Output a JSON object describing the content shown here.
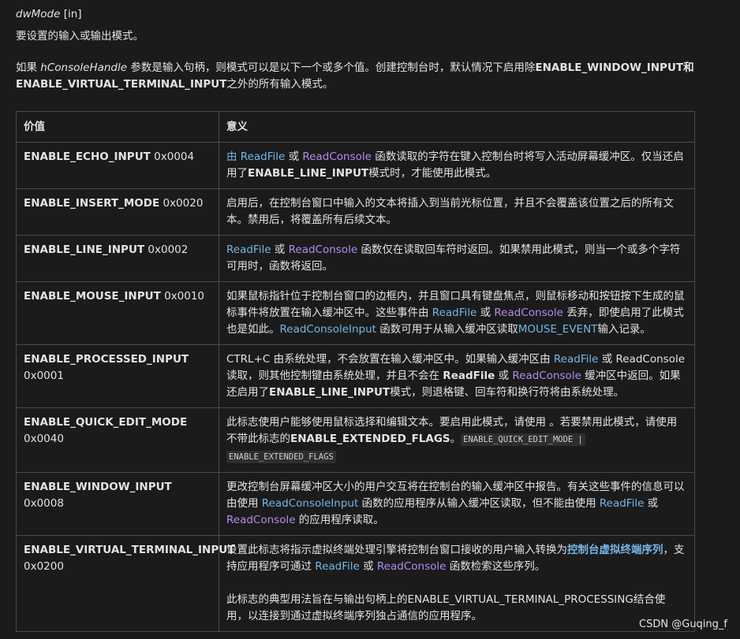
{
  "param": {
    "name": "dwMode",
    "tag": " [in]"
  },
  "description": "要设置的输入或输出模式。",
  "intro": {
    "p1": "如果 ",
    "handle": "hConsoleHandle",
    "p2": " 参数是输入句柄，则模式可以是以下一个或多个值。创建控制台时，默认情况下启用除",
    "bold": "ENABLE_WINDOW_INPUT和ENABLE_VIRTUAL_TERMINAL_INPUT",
    "p3": "之外的所有输入模式。"
  },
  "table": {
    "headers": [
      "价值",
      "意义"
    ],
    "rows": [
      {
        "name": "ENABLE_ECHO_INPUT",
        "value": " 0x0004",
        "m1": "由 ",
        "m2": "ReadFile",
        "m3": " 或 ",
        "m4": "ReadConsole",
        "m5": " 函数读取的字符在键入控制台时将写入活动屏幕缓冲区。仅当还启用了",
        "m6": "ENABLE_LINE_INPUT",
        "m7": "模式时，才能使用此模式。"
      },
      {
        "name": "ENABLE_INSERT_MODE",
        "value": " 0x0020",
        "m1": "启用后，在控制台窗口中输入的文本将插入到当前光标位置，并且不会覆盖该位置之后的所有文本。禁用后，将覆盖所有后续文本。"
      },
      {
        "name": "ENABLE_LINE_INPUT",
        "value": " 0x0002",
        "m1": "ReadFile",
        "m2": " 或 ",
        "m3": "ReadConsole",
        "m4": " 函数仅在读取回车符时返回。如果禁用此模式，则当一个或多个字符可用时，函数将返回。"
      },
      {
        "name": "ENABLE_MOUSE_INPUT",
        "value": " 0x0010",
        "m1": "如果鼠标指针位于控制台窗口的边框内，并且窗口具有键盘焦点，则鼠标移动和按钮按下生成的鼠标事件将放置在输入缓冲区中。这些事件由 ",
        "m2": "ReadFile",
        "m3": " 或 ",
        "m4": "ReadConsole",
        "m5": " 丢弃，即使启用了此模式也是如此。",
        "m6": "ReadConsoleInput",
        "m7": " 函数可用于从输入缓冲区读取",
        "m8": "MOUSE_EVENT",
        "m9": "输入记录。"
      },
      {
        "name": "ENABLE_PROCESSED_INPUT",
        "value": " 0x0001",
        "m1": "CTRL+C 由系统处理，不会放置在输入缓冲区中。如果输入缓冲区由 ",
        "m2": "ReadFile",
        "m3": " 或 ReadConsole 读取，则其他控制键由系统处理，并且不会在 ",
        "m4": "ReadFile",
        "m5": " 或 ",
        "m6": "ReadConsole",
        "m7": " 缓冲区中返回。如果还启用了",
        "m8": "ENABLE_LINE_INPUT",
        "m9": "模式，则退格键、回车符和换行符将由系统处理。"
      },
      {
        "name": "ENABLE_QUICK_EDIT_MODE",
        "value": " 0x0040",
        "m1": "此标志使用户能够使用鼠标选择和编辑文本。要启用此模式，请使用 。若要禁用此模式，请使用不带此标志的",
        "m2": "ENABLE_EXTENDED_FLAGS",
        "m3": "。",
        "code1": "ENABLE_QUICK_EDIT_MODE |",
        "code2": "ENABLE_EXTENDED_FLAGS"
      },
      {
        "name": "ENABLE_WINDOW_INPUT",
        "value": " 0x0008",
        "m1": "更改控制台屏幕缓冲区大小的用户交互将在控制台的输入缓冲区中报告。有关这些事件的信息可以由使用 ",
        "m2": "ReadConsoleInput",
        "m3": " 函数的应用程序从输入缓冲区读取，但不能由使用 ",
        "m4": "ReadFile",
        "m5": " 或 ",
        "m6": "ReadConsole",
        "m7": " 的应用程序读取。"
      },
      {
        "name": "ENABLE_VIRTUAL_TERMINAL_INPUT",
        "value": "0x0200",
        "m1": "设置此标志将指示虚拟终端处理引擎将控制台窗口接收的用户输入转换为",
        "m2": "控制台虚拟终端序列",
        "m3": "，支持应用程序可通过 ",
        "m4": "ReadFile",
        "m5": " 或 ",
        "m6": "ReadConsole",
        "m7": " 函数检索这些序列。",
        "p2": "此标志的典型用法旨在与输出句柄上的ENABLE_VIRTUAL_TERMINAL_PROCESSING结合使用，以连接到通过虚拟终端序列独占通信的应用程序。"
      }
    ]
  },
  "watermark": "CSDN @Guqing_f"
}
